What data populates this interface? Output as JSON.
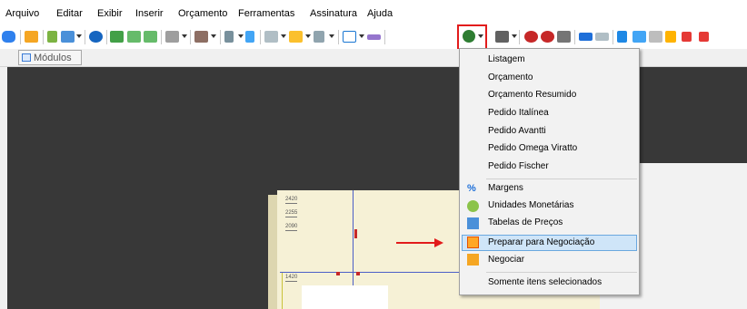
{
  "menubar": {
    "items": [
      "Arquivo",
      "Editar",
      "Exibir",
      "Inserir",
      "Orçamento",
      "Ferramentas",
      "Assinatura",
      "Ajuda"
    ]
  },
  "modules": {
    "tab_label": "Módulos"
  },
  "dropdown": {
    "items": [
      {
        "label": "Listagem",
        "icon": "none"
      },
      {
        "label": "Orçamento",
        "icon": "none"
      },
      {
        "label": "Orçamento Resumido",
        "icon": "none"
      },
      {
        "label": "Pedido Italínea",
        "icon": "none"
      },
      {
        "label": "Pedido Avantti",
        "icon": "none"
      },
      {
        "label": "Pedido Omega Viratto",
        "icon": "none"
      },
      {
        "label": "Pedido Fischer",
        "icon": "none"
      },
      {
        "label": "Margens",
        "icon": "percent-icon"
      },
      {
        "label": "Unidades Monetárias",
        "icon": "coins-icon"
      },
      {
        "label": "Tabelas de Preços",
        "icon": "price-table-icon"
      },
      {
        "label": "Preparar para Negociação",
        "icon": "floppy-disk-icon",
        "highlighted": true
      },
      {
        "label": "Negociar",
        "icon": "person-icon"
      },
      {
        "label": "Somente itens selecionados",
        "icon": "none"
      }
    ]
  },
  "scene": {
    "dims": [
      "2420",
      "2255",
      "2090",
      "1420"
    ],
    "vertical_mark": "1670"
  },
  "colors": {
    "accent_red": "#e21b1b",
    "hover_bg": "#cfe5f8",
    "viewport_bg": "#383838"
  }
}
